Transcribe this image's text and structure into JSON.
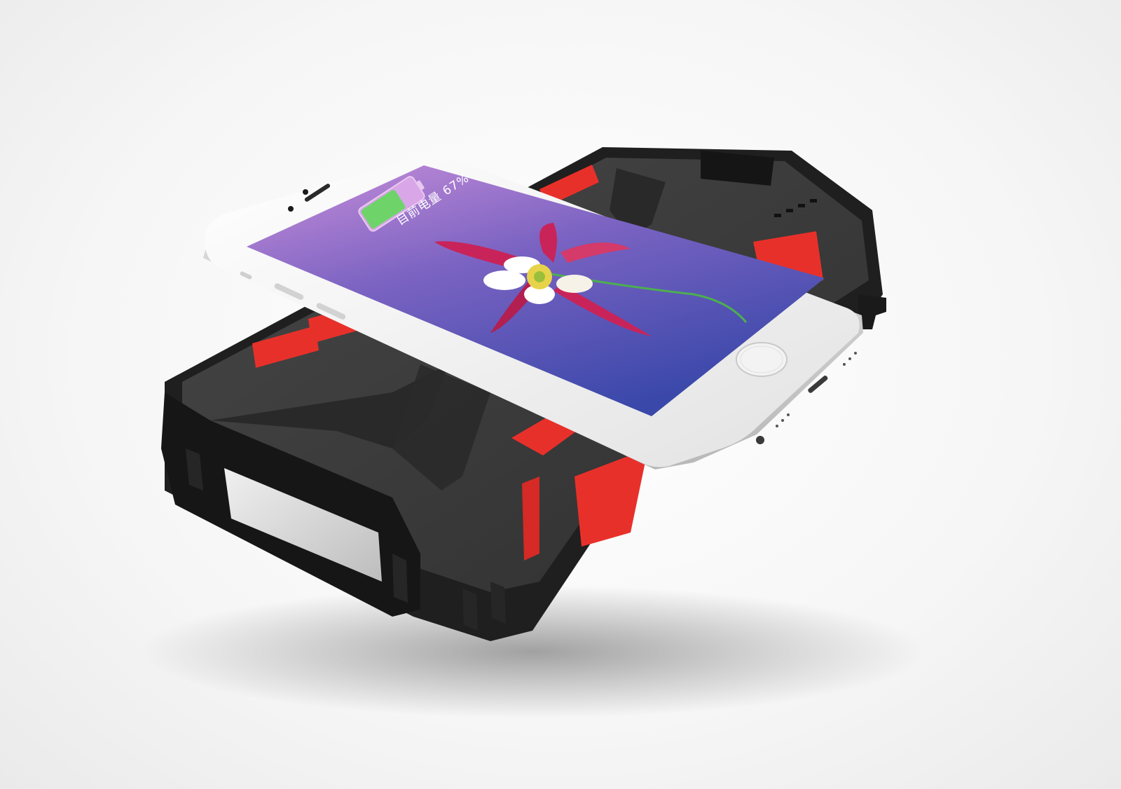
{
  "screen": {
    "battery_text": "目前电量 67%",
    "battery_level": 0.67
  },
  "colors": {
    "case_black": "#2a2a2a",
    "case_top": "#3a3a3a",
    "accent_red": "#e8302a",
    "phone_body": "#f4f4f4",
    "screen_top": "#c48ad9",
    "screen_bottom": "#3b49a8",
    "battery_green": "#6ed46a"
  },
  "icons": {
    "battery": "battery-icon",
    "flower": "flower-image",
    "home": "home-button-icon"
  }
}
